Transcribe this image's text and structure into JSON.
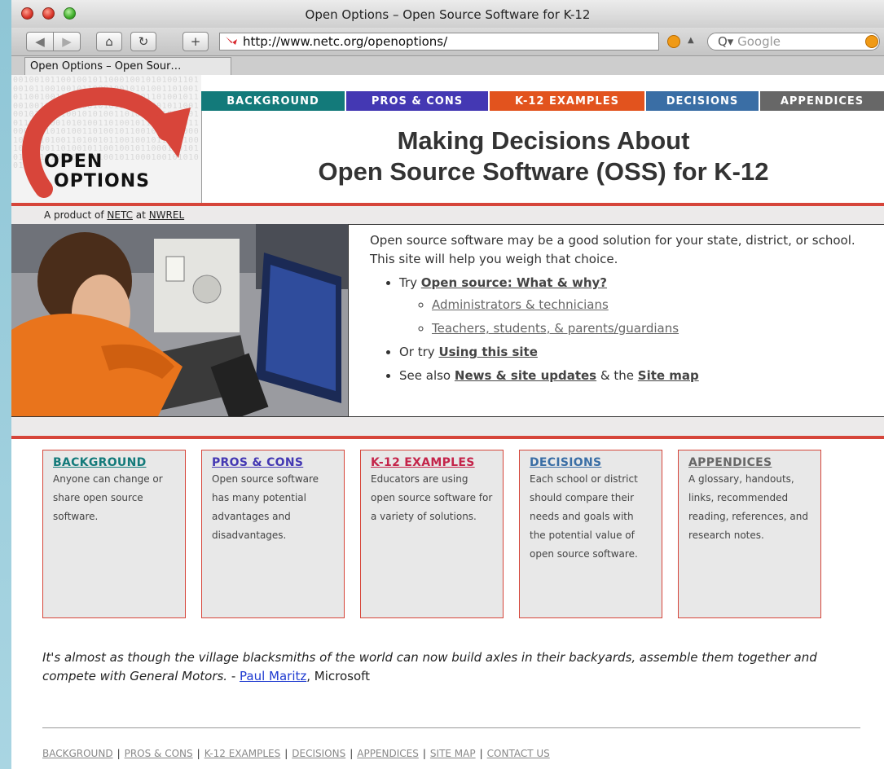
{
  "browser": {
    "window_title": "Open Options – Open Source Software for K-12",
    "url": "http://www.netc.org/openoptions/",
    "search_placeholder": "Google",
    "tab_label": "Open Options – Open Sour…"
  },
  "logo": {
    "line1": "OPEN",
    "line2": "OPTIONS",
    "binary_text": "0010010110010010110001001010100110100101100100101100010010101001101001011001001011000100101010011010010110010010110001001010100110100101100100101100010010101001101001011001001011000100101010011010010110010010110001001010100110100101100100101100010010101001101001011001001011000100101010011010010110010010110001001010100110100101100100101100010010101001"
  },
  "nav": [
    {
      "label": "BACKGROUND",
      "color": "#137a7a"
    },
    {
      "label": "PROS & CONS",
      "color": "#4438b3"
    },
    {
      "label": "K-12 EXAMPLES",
      "color": "#e2531e"
    },
    {
      "label": "DECISIONS",
      "color": "#3a6ea5"
    },
    {
      "label": "APPENDICES",
      "color": "#676767"
    }
  ],
  "banner": {
    "line1": "Making Decisions About",
    "line2": "Open Source Software (OSS) for K-12"
  },
  "credit": {
    "prefix": "A product of",
    "link1": "NETC",
    "middle": "at",
    "link2": "NWREL"
  },
  "intro": {
    "paragraph": "Open source software may be a good solution for your state, district, or school. This site will help you weigh that choice.",
    "try_prefix": "Try",
    "try_link": "Open source: What & why?",
    "sub_links": [
      "Administrators & technicians",
      "Teachers, students, & parents/guardians"
    ],
    "or_prefix": "Or try",
    "or_link": "Using this site",
    "see_prefix": "See also",
    "see_link1": "News & site updates",
    "see_middle": "& the",
    "see_link2": "Site map"
  },
  "cards": [
    {
      "title": "BACKGROUND",
      "color": "#137a7a",
      "desc": "Anyone can change or share open source software."
    },
    {
      "title": "PROS & CONS",
      "color": "#4438b3",
      "desc": "Open source software has many potential advantages and disadvantages."
    },
    {
      "title": "K-12 EXAMPLES",
      "color": "#c4244a",
      "desc": "Educators are using open source software for a variety of solutions."
    },
    {
      "title": "DECISIONS",
      "color": "#3a6ea5",
      "desc": "Each school or district should compare their needs and goals with the potential value of open source software."
    },
    {
      "title": "APPENDICES",
      "color": "#676767",
      "desc": "A glossary, handouts, links, recommended reading, references, and research notes."
    }
  ],
  "quote": {
    "text": "It's almost as though the village blacksmiths of the world can now build axles in their backyards, assemble them together and compete with General Motors.",
    "dash": " - ",
    "author": "Paul Maritz",
    "org": ", Microsoft"
  },
  "footer": [
    "BACKGROUND",
    "PROS & CONS",
    "K-12 EXAMPLES",
    "DECISIONS",
    "APPENDICES",
    "SITE MAP",
    "CONTACT US"
  ],
  "footer_separator": "|"
}
